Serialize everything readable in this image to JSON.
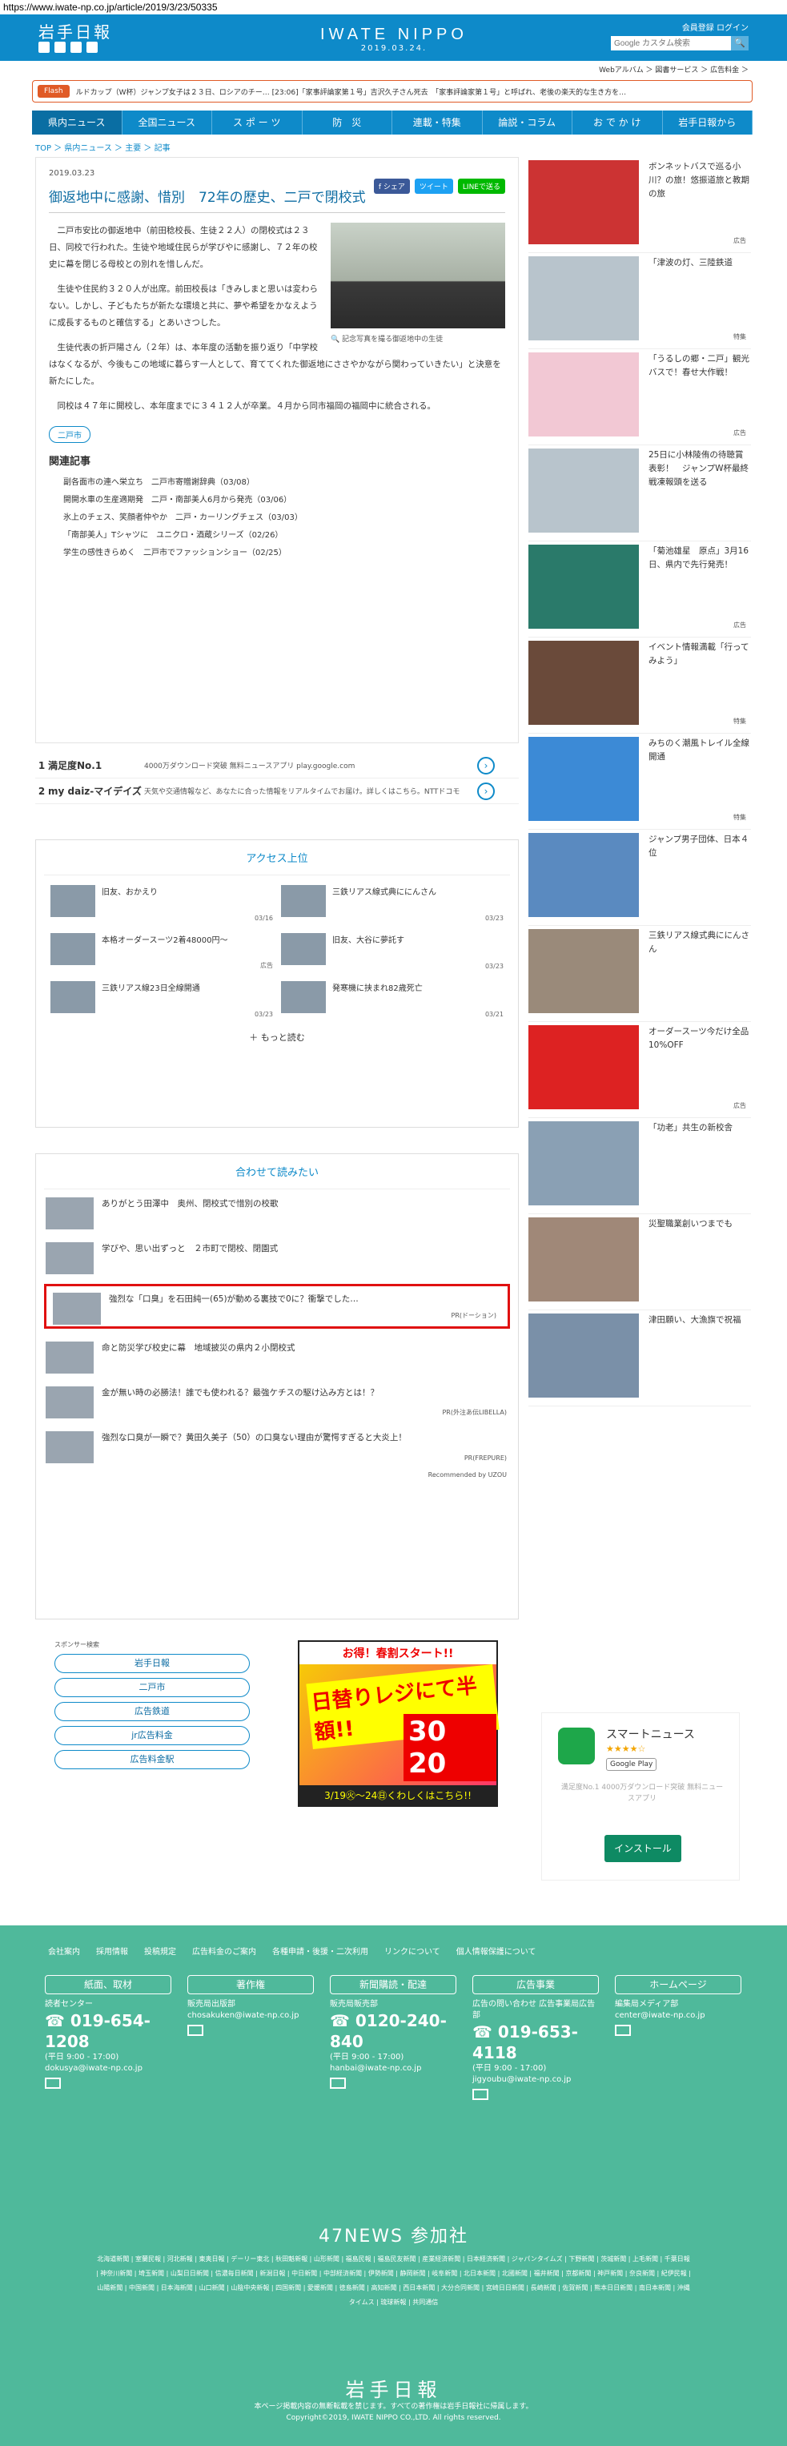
{
  "url": "https://www.iwate-np.co.jp/article/2019/3/23/50335",
  "header": {
    "logo": "岩手日報",
    "brand": "IWATE NIPPO",
    "date": "2019.03.24.",
    "member_links": "会員登録  ログイン",
    "search_placeholder": "Google カスタム検索",
    "search_btn": "🔍"
  },
  "subnav": "Webアルバム ＞ 図書サービス ＞ 広告料金 ＞",
  "flash": {
    "tag": "Flash",
    "text": "ルドカップ（W杯）ジャンプ女子は２３日、ロシアのチー… [23:06]「家事評論家第１号」吉沢久子さん死去　「家事評論家第１号」と呼ばれ、老後の楽天的な生き方を…"
  },
  "gnav": [
    "県内ニュース",
    "全国ニュース",
    "ス ポ ー ツ",
    "防　災",
    "連載・特集",
    "論説・コラム",
    "お で か け",
    "岩手日報から"
  ],
  "breadcrumb": "TOP ＞ 県内ニュース ＞ 主要 ＞ 記事",
  "article": {
    "date": "2019.03.23",
    "share": [
      "f シェア",
      "ツイート",
      "LINEで送る"
    ],
    "title": "御返地中に感謝、惜別　72年の歴史、二戸で閉校式",
    "p1": "　二戸市安比の御返地中（前田稔校長、生徒２２人）の閉校式は２３日、同校で行われた。生徒や地域住民らが学びやに感謝し、７２年の校史に幕を閉じる母校との別れを惜しんだ。",
    "p2": "　生徒や住民約３２０人が出席。前田校長は「きみしまと思いは変わらない。しかし、子どもたちが新たな環境と共に、夢や希望をかなえように成長するものと確信する」とあいさつした。",
    "p3": "　生徒代表の折戸陽さん（２年）は、本年度の活動を振り返り「中学校はなくなるが、今後もこの地域に暮らす一人として、育ててくれた御返地にささやかながら関わっていきたい」と決意を新たにした。",
    "p4": "　同校は４７年に開校し、本年度までに３４１２人が卒業。４月から同市福岡の福岡中に統合される。",
    "photo_caption": "記念写真を撮る御返地中の生徒",
    "tag": "二戸市",
    "related_heading": "関連記事",
    "related": [
      "副各面市の連へ栄立ち　二戸市寄贈謝辞典（03/08）",
      "開開水車の生産適期発　二戸・南部美人6月から発売（03/06）",
      "氷上のチェス、笑顔者仲やか　二戸・カーリングチェス（03/03）",
      "「南部美人」Tシャツに　ユニクロ・酒蔵シリーズ（02/26）",
      "学生の感性きらめく　二戸市でファッションショー（02/25）"
    ]
  },
  "ads": [
    {
      "n": "1",
      "title": "満足度No.1",
      "desc": "4000万ダウンロード突破 無料ニュースアプリ play.google.com"
    },
    {
      "n": "2",
      "title": "my daiz-マイデイズ",
      "desc": "天気や交通情報など、あなたに合った情報をリアルタイムでお届け。詳しくはこちら。NTTドコモ"
    }
  ],
  "access": {
    "heading": "アクセス上位",
    "items": [
      {
        "title": "旧友、おかえり",
        "date": "03/16"
      },
      {
        "title": "三鉄リアス線式典ににんさん",
        "date": "03/23"
      },
      {
        "title": "本格オーダースーツ2着48000円〜",
        "date": "広告"
      },
      {
        "title": "旧友、大谷に夢託す",
        "date": "03/23"
      },
      {
        "title": "三鉄リアス線23日全線開通",
        "date": "03/23"
      },
      {
        "title": "発寒機に挟まれ82歳死亡",
        "date": "03/21"
      }
    ],
    "more": "＋ もっと読む"
  },
  "reco": {
    "heading": "合わせて読みたい",
    "items": [
      {
        "title": "ありがとう田澤中　奥州、閉校式で惜別の校歌",
        "pr": ""
      },
      {
        "title": "学びや、思い出ずっと　２市町で閉校、閉園式",
        "pr": ""
      },
      {
        "title": "強烈な「口臭」を石田純一(65)が動める裏技で0に？衝撃でした…",
        "pr": "PR(ドーション)"
      },
      {
        "title": "命と防災学び校史に幕　地域披災の県内２小閉校式",
        "pr": ""
      },
      {
        "title": "金が無い時の必勝法！誰でも使われる？最強ケチスの駆け込み方とは！？",
        "pr": "PR(外注あ伝LIBELLA)"
      },
      {
        "title": "強烈な口臭が一瞬で？黄田久美子（50）の口臭ない理由が驚愕すぎると大炎上！",
        "pr": "PR(FREPURE)"
      }
    ],
    "by": "Recommended by UZOU"
  },
  "sponsor": {
    "heading": "スポンサー検索",
    "items": [
      "岩手日報",
      "二戸市",
      "広告鉄道",
      "jr広告料金",
      "広告料金駅"
    ]
  },
  "banner": {
    "top": "お得！春割スタート!!",
    "b1": "日替りレジにて半額!!",
    "b2": "30 20",
    "bottom": "3/19㊋〜24㊐くわしくはこちら!!"
  },
  "right": [
    {
      "title": "ボンネットバスで巡る小川？の旅！悠振道旅と教期の旅",
      "label": "広告"
    },
    {
      "title": "「津波の灯、三陸鉄道",
      "label": "特集"
    },
    {
      "title": "「うるしの郷・二戸」観光バスで！春せ大作戦！",
      "label": "広告"
    },
    {
      "title": "25日に小林陵侑の待聴賞表彰！　ジャンプW杯最終戦凍報頭を送る",
      "label": ""
    },
    {
      "title": "「菊池雄星　原点」3月16日、県内で先行発売！",
      "label": "広告"
    },
    {
      "title": "イベント情報満載「行ってみよう」",
      "label": "特集"
    },
    {
      "title": "みちのく潮風トレイル全線開通",
      "label": "特集"
    },
    {
      "title": "ジャンプ男子団体、日本４位",
      "label": ""
    },
    {
      "title": "三鉄リアス線式典ににんさん",
      "label": ""
    },
    {
      "title": "オーダースーツ今だけ全品10%OFF",
      "label": "広告"
    },
    {
      "title": "「功老」共生の新校舎",
      "label": ""
    },
    {
      "title": "災聖職業創いつまでも",
      "label": ""
    },
    {
      "title": "津田願い、大漁旗で祝福",
      "label": ""
    }
  ],
  "smart": {
    "name": "スマートニュース",
    "stars": "★★★★☆",
    "store": "Google Play",
    "desc": "満足度No.1\n4000万ダウンロード突破 無料ニュースアプリ",
    "btn": "インストール"
  },
  "footer": {
    "links": [
      "会社案内",
      "採用情報",
      "投稿規定",
      "広告料金のご案内",
      "各種申請・後援・二次利用",
      "リンクについて",
      "個人情報保護について"
    ],
    "cols": [
      {
        "title": "紙面、取材",
        "sub": "読者センター",
        "phone": "019-654-1208",
        "hours": "(平日 9:00 - 17:00)",
        "mail": "dokusya@iwate-np.co.jp"
      },
      {
        "title": "著作権",
        "sub": "販売局出版部",
        "phone": "",
        "hours": "",
        "mail": "chosakuken@iwate-np.co.jp"
      },
      {
        "title": "新聞購読・配達",
        "sub": "販売局販売部",
        "phone": "0120-240-840",
        "hours": "(平日 9:00 - 17:00)",
        "mail": "hanbai@iwate-np.co.jp"
      },
      {
        "title": "広告事業",
        "sub": "広告の問い合わせ 広告事業局広告部",
        "phone": "019-653-4118",
        "hours": "(平日 9:00 - 17:00)",
        "mail": "jigyoubu@iwate-np.co.jp"
      },
      {
        "title": "ホームページ",
        "sub": "編集局メディア部",
        "phone": "",
        "hours": "",
        "mail": "center@iwate-np.co.jp"
      }
    ],
    "heading47": "47NEWS 参加社",
    "papers": "北海道新聞 | 室蘭民報 | 河北新報 | 東奥日報 | デーリー東北 | 秋田魁新報 | 山形新聞 | 福島民報 | 福島民友新聞 | 産業経済新聞 | 日本経済新聞 | ジャパンタイムズ | 下野新聞 | 茨城新聞 | 上毛新聞 | 千葉日報 | 神奈川新聞 | 埼玉新聞 | 山梨日日新聞 | 信濃毎日新聞 | 新潟日報 | 中日新聞 | 中部経済新聞 | 伊勢新聞 | 静岡新聞 | 岐阜新聞 | 北日本新聞 | 北國新聞 | 福井新聞 | 京都新聞 | 神戸新聞 | 奈良新聞 | 紀伊民報 | 山陽新聞 | 中国新聞 | 日本海新聞 | 山口新聞 | 山陰中央新報 | 四国新聞 | 愛媛新聞 | 徳島新聞 | 高知新聞 | 西日本新聞 | 大分合同新聞 | 宮崎日日新聞 | 長崎新聞 | 佐賀新聞 | 熊本日日新聞 | 南日本新聞 | 沖縄タイムス | 琉球新報 | 共同通信",
    "logo": "岩手日報",
    "copy1": "本ページ掲載内容の無断転載を禁じます。すべての著作権は岩手日報社に帰属します。",
    "copy2": "Copyright©2019, IWATE NIPPO CO.,LTD. All rights reserved."
  }
}
